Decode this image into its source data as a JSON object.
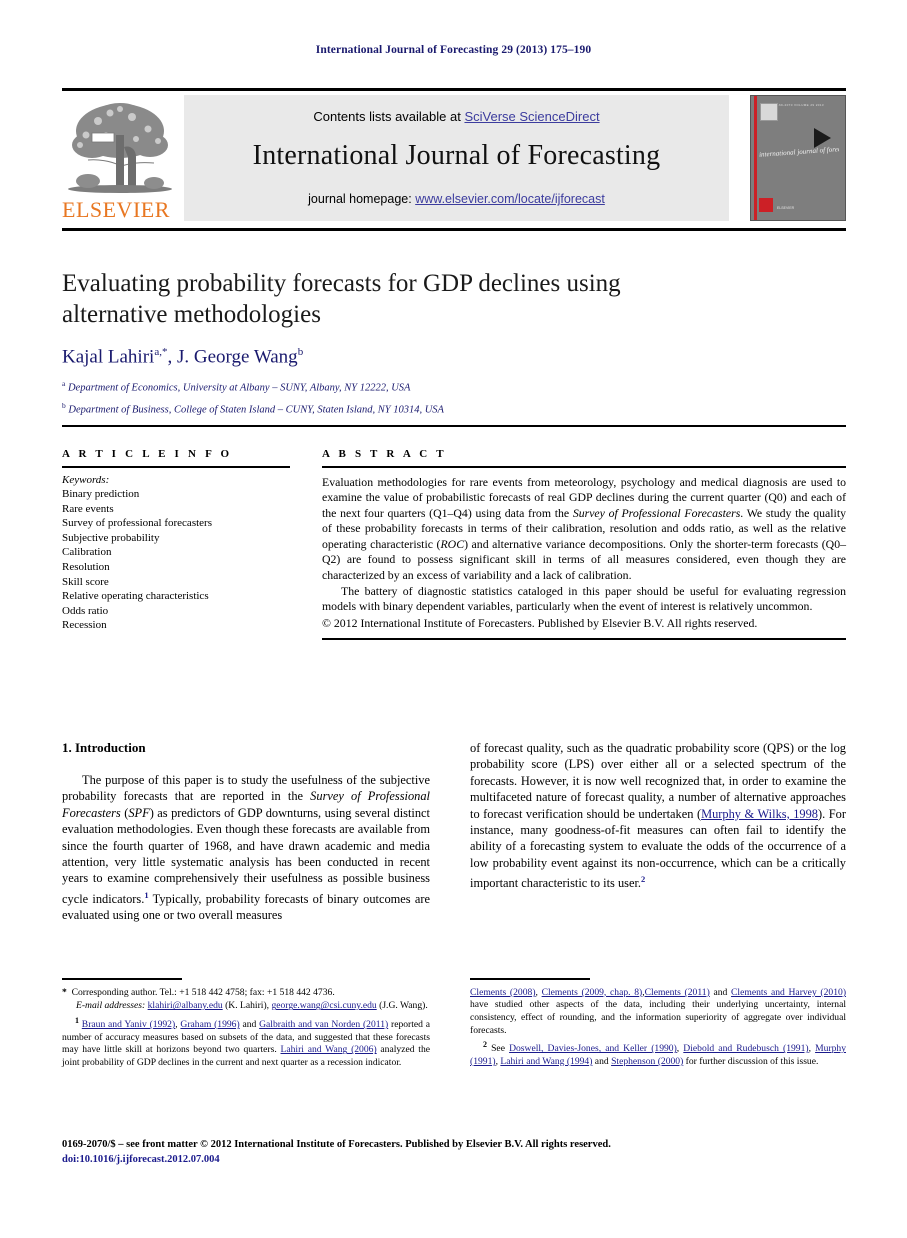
{
  "running_head": "International Journal of Forecasting 29 (2013) 175–190",
  "masthead": {
    "publisher_wordmark": "ELSEVIER",
    "contents_prefix": "Contents lists available at ",
    "contents_link": "SciVerse ScienceDirect",
    "journal_title": "International Journal of Forecasting",
    "homepage_prefix": "journal homepage: ",
    "homepage_link": "www.elsevier.com/locate/ijforecast",
    "cover": {
      "title_script": "international journal of forecasting",
      "top_meta": "ISSN 0169-2070        VOLUME 29        2013",
      "bottom_meta": "ELSEVIER"
    }
  },
  "title_block": {
    "title": "Evaluating probability forecasts for GDP declines using alternative methodologies",
    "author_1": "Kajal Lahiri",
    "author_1_sup": "a,*",
    "author_sep": ", ",
    "author_2": "J. George Wang",
    "author_2_sup": "b",
    "affiliation_a_sup": "a",
    "affiliation_a": "Department of Economics, University at Albany – SUNY, Albany, NY 12222, USA",
    "affiliation_b_sup": "b",
    "affiliation_b": "Department of Business, College of Staten Island – CUNY, Staten Island, NY 10314, USA"
  },
  "article_info": {
    "heading": "A R T I C L E    I N F O",
    "keywords_label": "Keywords:",
    "keywords": [
      "Binary prediction",
      "Rare events",
      "Survey of professional forecasters",
      "Subjective probability",
      "Calibration",
      "Resolution",
      "Skill score",
      "Relative operating characteristics",
      "Odds ratio",
      "Recession"
    ]
  },
  "abstract": {
    "heading": "A B S T R A C T",
    "para1_a": "Evaluation methodologies for rare events from meteorology, psychology and medical diagnosis are used to examine the value of probabilistic forecasts of real GDP declines during the current quarter (Q0) and each of the next four quarters (Q1–Q4) using data from the ",
    "para1_italic1": "Survey of Professional Forecasters",
    "para1_b": ". We study the quality of these probability forecasts in terms of their calibration, resolution and odds ratio, as well as the relative operating characteristic (",
    "para1_italic2": "ROC",
    "para1_c": ") and alternative variance decompositions. Only the shorter-term forecasts (Q0–Q2) are found to possess significant skill in terms of all measures considered, even though they are characterized by an excess of variability and a lack of calibration.",
    "para2": "The battery of diagnostic statistics cataloged in this paper should be useful for evaluating regression models with binary dependent variables, particularly when the event of interest is relatively uncommon.",
    "copyright": "© 2012 International Institute of Forecasters. Published by Elsevier B.V. All rights reserved."
  },
  "body": {
    "section_heading": "1. Introduction",
    "left_a": "The purpose of this paper is to study the usefulness of the subjective probability forecasts that are reported in the ",
    "left_italic1": "Survey of Professional Forecasters",
    "left_b": " (",
    "left_italic2": "SPF",
    "left_c": ") as predictors of GDP downturns, using several distinct evaluation methodologies. Even though these forecasts are available from since the fourth quarter of 1968, and have drawn academic and media attention, very little systematic analysis has been conducted in recent years to examine comprehensively their usefulness as possible business cycle indicators.",
    "left_fn_mark": "1",
    "left_d": " Typically, probability forecasts of binary outcomes are evaluated using one or two overall measures",
    "right_a": "of forecast quality, such as the quadratic probability score (QPS) or the log probability score (LPS) over either all or a selected spectrum of the forecasts. However, it is now well recognized that, in order to examine the multifaceted nature of forecast quality, a number of alternative approaches to forecast verification should be undertaken (",
    "right_cite1": "Murphy & Wilks, 1998",
    "right_b": "). For instance, many goodness-of-fit measures can often fail to identify the ability of a forecasting system to evaluate the odds of the occurrence of a low probability event against its non-occurrence, which can be a critically important characteristic to its user.",
    "right_fn_mark": "2"
  },
  "footnotes": {
    "star_mark": "*",
    "star_text": "Corresponding author. Tel.: +1 518 442 4758; fax: +1 518 442 4736.",
    "email_label": "E-mail addresses:",
    "email_1": "klahiri@albany.edu",
    "email_1_who": " (K. Lahiri),",
    "email_2": "george.wang@csi.cuny.edu",
    "email_2_who": " (J.G. Wang).",
    "fn1_mark": "1",
    "fn1_cite1": "Braun and Yaniv (1992)",
    "fn1_t1": ", ",
    "fn1_cite2": "Graham (1996)",
    "fn1_t2": " and ",
    "fn1_cite3": "Galbraith and van Norden (2011)",
    "fn1_t3": " reported a number of accuracy measures based on subsets of the data, and suggested that these forecasts may have little skill at horizons beyond two quarters. ",
    "fn1_cite4": "Lahiri and Wang (2006)",
    "fn1_t4": " analyzed the joint probability of GDP declines in the current and next quarter as a recession indicator. ",
    "fn1_cite5": "Clements (2008)",
    "fn1_t5": ", ",
    "fn1_cite6": "Clements (2009, chap. 8)",
    "fn1_t6": ",",
    "fn1_cite7": "Clements (2011)",
    "fn1_t7": " and ",
    "fn1_cite8": "Clements and Harvey (2010)",
    "fn1_t8": " have studied other aspects of the data, including their underlying uncertainty, internal consistency, effect of rounding, and the information superiority of aggregate over individual forecasts.",
    "fn2_mark": "2",
    "fn2_t0": " See ",
    "fn2_cite1": "Doswell, Davies-Jones, and Keller (1990)",
    "fn2_t1": ", ",
    "fn2_cite2": "Diebold and Rudebusch (1991)",
    "fn2_t2": ", ",
    "fn2_cite3": "Murphy (1991)",
    "fn2_t3": ", ",
    "fn2_cite4": "Lahiri and Wang (1994)",
    "fn2_t4": " and ",
    "fn2_cite5": "Stephenson (2000)",
    "fn2_t5": " for further discussion of this issue."
  },
  "bottom_matter": {
    "copyright_line": "0169-2070/$ – see front matter © 2012 International Institute of Forecasters. Published by Elsevier B.V. All rights reserved.",
    "doi": "doi:10.1016/j.ijforecast.2012.07.004"
  },
  "colors": {
    "link_blue": "#3c3c9e",
    "cite_blue": "#1a1a8c",
    "author_blue": "#1a1a6e",
    "elsevier_orange": "#E87722",
    "banner_gray": "#e9e9e9"
  }
}
